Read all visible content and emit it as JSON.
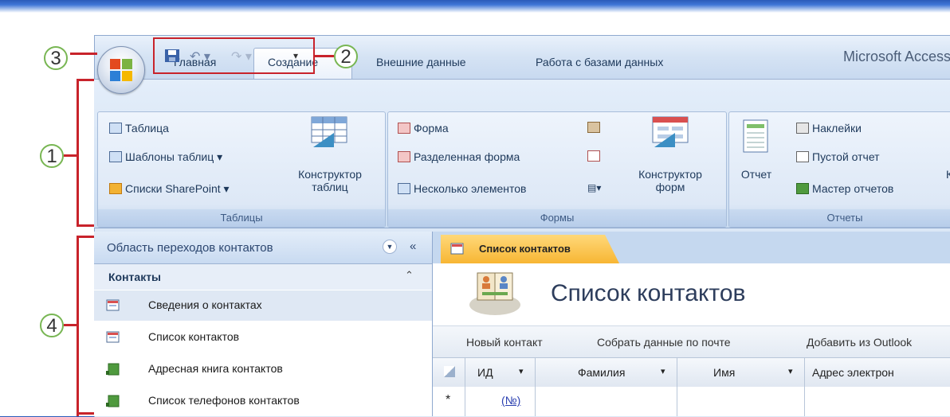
{
  "window": {
    "app_title": "Microsoft Access"
  },
  "callouts": {
    "c1": "1",
    "c2": "2",
    "c3": "3",
    "c4": "4"
  },
  "tabs": [
    "Главная",
    "Создание",
    "Внешние данные",
    "Работа с базами данных"
  ],
  "ribbon": {
    "tables": {
      "label": "Таблицы",
      "table": "Таблица",
      "templates": "Шаблоны таблиц",
      "sharepoint": "Списки SharePoint",
      "designer": [
        "Конструктор",
        "таблиц"
      ]
    },
    "forms": {
      "label": "Формы",
      "form": "Форма",
      "split": "Разделенная форма",
      "multiple": "Несколько элементов",
      "designer": [
        "Конструктор",
        "форм"
      ]
    },
    "reports": {
      "label": "Отчеты",
      "report": "Отчет",
      "labels": "Наклейки",
      "blank": "Пустой отчет",
      "wizard": "Мастер отчетов",
      "designer_cut": "К"
    }
  },
  "nav": {
    "header": "Область переходов контактов",
    "group": "Контакты",
    "items": [
      "Сведения о контактах",
      "Список контактов",
      "Адресная книга контактов",
      "Список телефонов контактов"
    ]
  },
  "doc": {
    "tab": "Список контактов",
    "title": "Список контактов",
    "actions": [
      "Новый контакт",
      "Собрать данные по почте",
      "Добавить из Outlook"
    ],
    "columns": [
      "ИД",
      "Фамилия",
      "Имя",
      "Адрес электрон"
    ],
    "new_row_marker": "*",
    "new_row_id": "(№)"
  },
  "colors": {
    "callout_border": "#78b653",
    "callout_line": "#c8232b",
    "tab_active": "#f7b634"
  }
}
